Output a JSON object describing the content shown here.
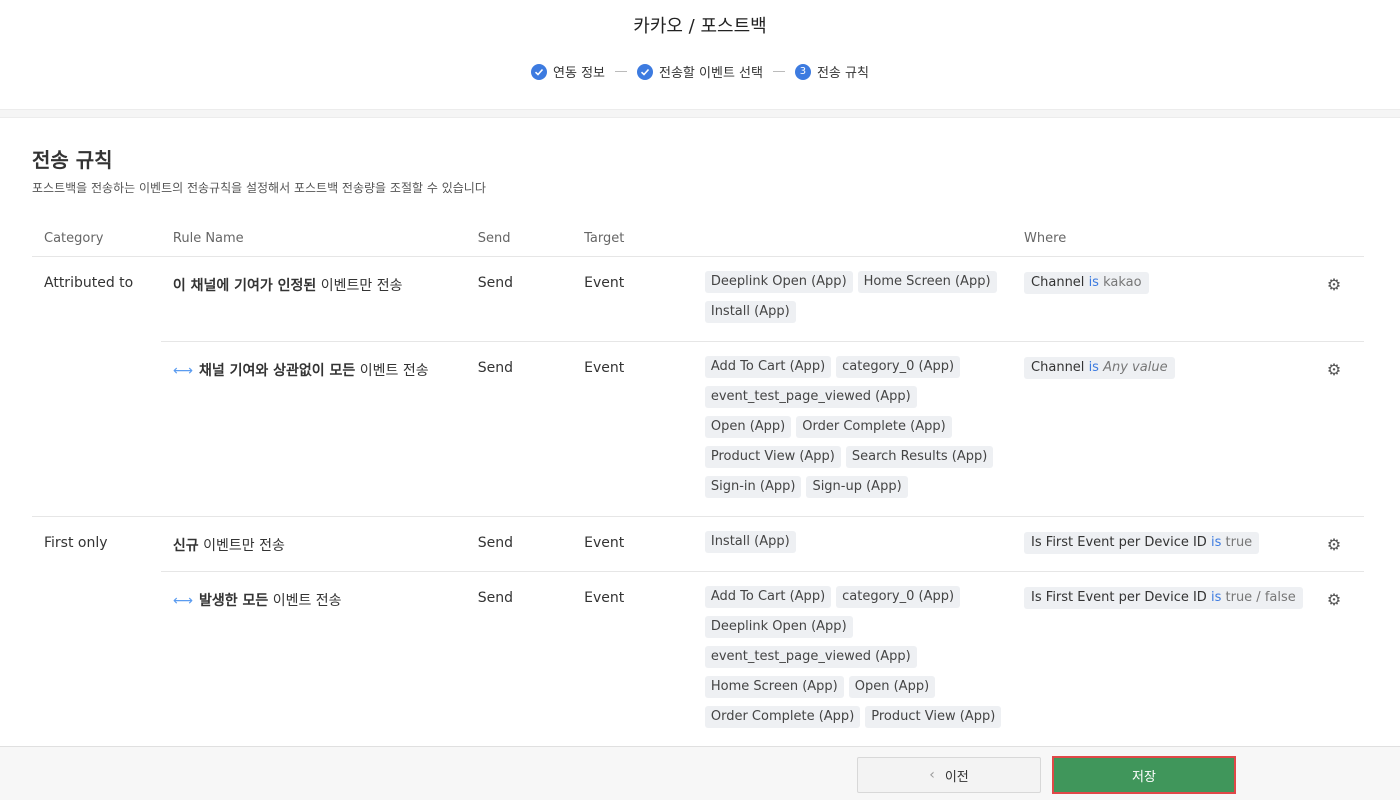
{
  "header": {
    "title": "카카오 / 포스트백",
    "steps": [
      {
        "label": "연동 정보",
        "state": "done"
      },
      {
        "label": "전송할 이벤트 선택",
        "state": "done"
      },
      {
        "label": "전송 규칙",
        "number": "3",
        "state": "current"
      }
    ]
  },
  "section": {
    "title": "전송 규칙",
    "description": "포스트백을 전송하는 이벤트의 전송규칙을 설정해서 포스트백 전송량을 조절할 수 있습니다"
  },
  "table": {
    "headers": {
      "category": "Category",
      "rule_name": "Rule Name",
      "send": "Send",
      "target": "Target",
      "where": "Where"
    },
    "rows": [
      {
        "category": "Attributed to",
        "rule_bold": "이 채널에 기여가 인정된",
        "rule_rest": " 이벤트만 전송",
        "send": "Send",
        "target": "Event",
        "events": [
          "Deeplink Open (App)",
          "Home Screen (App)",
          "Install (App)"
        ],
        "where": {
          "field": "Channel",
          "op": "is",
          "value": "kakao"
        }
      },
      {
        "category": "",
        "rule_bold": "채널 기여와 상관없이 모든",
        "rule_rest": " 이벤트 전송",
        "send": "Send",
        "target": "Event",
        "events": [
          "Add To Cart (App)",
          "category_0 (App)",
          "event_test_page_viewed (App)",
          "Open (App)",
          "Order Complete (App)",
          "Product View (App)",
          "Search Results (App)",
          "Sign-in (App)",
          "Sign-up (App)"
        ],
        "where": {
          "field": "Channel",
          "op": "is",
          "value": "Any value"
        }
      },
      {
        "category": "First only",
        "rule_bold": "신규",
        "rule_rest": " 이벤트만 전송",
        "send": "Send",
        "target": "Event",
        "events": [
          "Install (App)"
        ],
        "where": {
          "field": "Is First Event per Device ID",
          "op": "is",
          "value": "true"
        }
      },
      {
        "category": "",
        "rule_bold": "발생한 모든",
        "rule_rest": " 이벤트 전송",
        "send": "Send",
        "target": "Event",
        "events": [
          "Add To Cart (App)",
          "category_0 (App)",
          "Deeplink Open (App)",
          "event_test_page_viewed (App)",
          "Home Screen (App)",
          "Open (App)",
          "Order Complete (App)",
          "Product View (App)"
        ],
        "where": {
          "field": "Is First Event per Device ID",
          "op": "is",
          "value": "true / false"
        }
      }
    ]
  },
  "footer": {
    "prev_label": "이전",
    "save_label": "저장"
  },
  "colors": {
    "accent": "#3d7be0",
    "save": "#40965b",
    "save_border": "#e04848"
  }
}
